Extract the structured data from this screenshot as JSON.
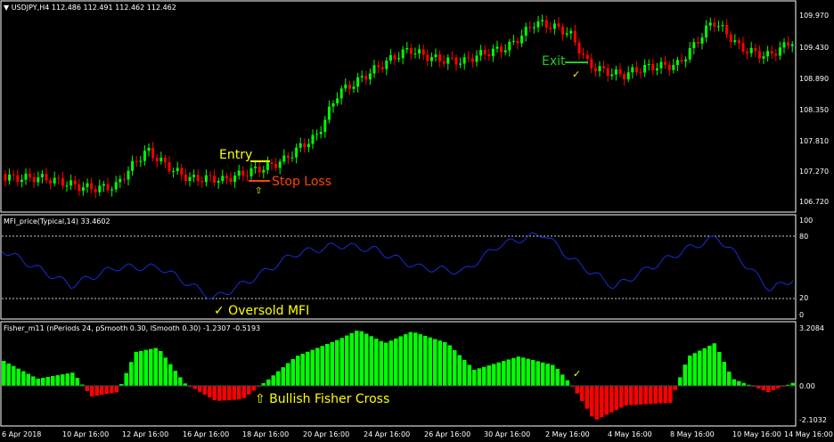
{
  "colors": {
    "background": "#000000",
    "frame": "#ffffff",
    "bull": "#00ff00",
    "bear": "#ff0000",
    "mfi_line": "#1a2bd8",
    "entry": "#ffff00",
    "stop": "#ff4500",
    "exit": "#22cc22",
    "annotation": "#ffff00"
  },
  "price_panel": {
    "header": "USDJPY,H4  112.486 112.491 112.462 112.462",
    "axis_ticks": [
      "109.970",
      "109.430",
      "108.890",
      "108.350",
      "107.810",
      "107.270",
      "106.720"
    ],
    "entry_label": "Entry",
    "stop_label": "Stop Loss",
    "exit_label": "Exit",
    "arrow_up": "⇧",
    "check": "✓"
  },
  "mfi_panel": {
    "header": "MFI_price(Typical,14) 33.4602",
    "axis_ticks": [
      "100",
      "80",
      "20",
      "0"
    ],
    "annotation": "✓ Oversold MFI"
  },
  "fisher_panel": {
    "header": "Fisher_m11  (nPeriods 24, pSmooth 0.30, lSmooth 0.30)  -1.2307 -0.5193",
    "axis_ticks": [
      "3.2084",
      "0.00",
      "-2.1032"
    ],
    "annotation": "⇧ Bullish Fisher Cross",
    "check": "✓"
  },
  "time_axis": [
    "6 Apr 2018",
    "10 Apr 16:00",
    "12 Apr 16:00",
    "16 Apr 16:00",
    "18 Apr 16:00",
    "20 Apr 16:00",
    "24 Apr 16:00",
    "26 Apr 16:00",
    "30 Apr 16:00",
    "2 May 16:00",
    "4 May 16:00",
    "8 May 16:00",
    "10 May 16:00",
    "14 May 16:00"
  ]
}
